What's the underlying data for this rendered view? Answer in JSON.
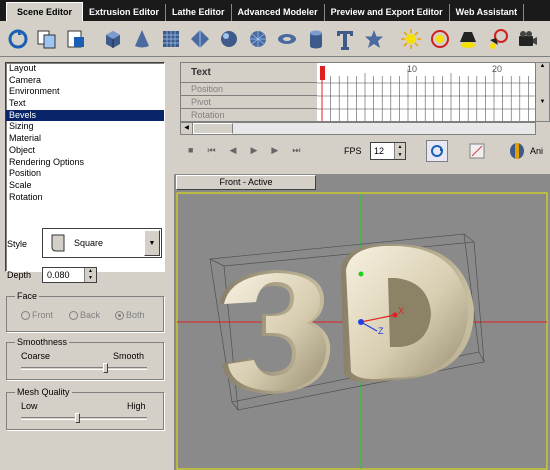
{
  "tabs": [
    "Scene Editor",
    "Extrusion Editor",
    "Lathe Editor",
    "Advanced Modeler",
    "Preview and Export Editor",
    "Web Assistant"
  ],
  "toolbar_icons": [
    "new-scene-icon",
    "copy-scene-icon",
    "paste-scene-icon",
    "cube-icon",
    "cone-icon",
    "plane-grid-icon",
    "pyramid-icon",
    "sphere-icon",
    "geosphere-icon",
    "torus-icon",
    "cylinder-icon",
    "text-icon",
    "star-icon",
    "light-icon",
    "omni-light-icon",
    "spotlight-icon",
    "target-light-icon",
    "camera-icon"
  ],
  "properties": [
    "Layout",
    "Camera",
    "Environment",
    "Text",
    "Bevels",
    "Sizing",
    "Material",
    "Object",
    "Rendering Options",
    "Position",
    "Scale",
    "Rotation"
  ],
  "selected_property": "Bevels",
  "style": {
    "label": "Style",
    "value": "Square"
  },
  "depth": {
    "label": "Depth",
    "value": "0.080"
  },
  "face": {
    "title": "Face",
    "options": [
      "Front",
      "Back",
      "Both"
    ],
    "selected": "Both"
  },
  "smoothness": {
    "title": "Smoothness",
    "low": "Coarse",
    "high": "Smooth",
    "level": 0.68
  },
  "mesh_quality": {
    "title": "Mesh Quality",
    "low": "Low",
    "high": "High",
    "level": 0.45
  },
  "timeline": {
    "rows": [
      "Text",
      "Position",
      "Pivot",
      "Rotation"
    ],
    "ticks": [
      "10",
      "20"
    ],
    "fps_label": "FPS",
    "fps_value": "12",
    "anim_label": "Ani"
  },
  "viewport": {
    "tab": "Front - Active",
    "text": "3D",
    "axis_x": "X",
    "axis_z": "Z"
  },
  "colors": {
    "selection": "#0a246a",
    "tabbar": "#1a1a1a",
    "viewport_bg": "#8a8a8a",
    "text3d": "#e8e0c8"
  }
}
